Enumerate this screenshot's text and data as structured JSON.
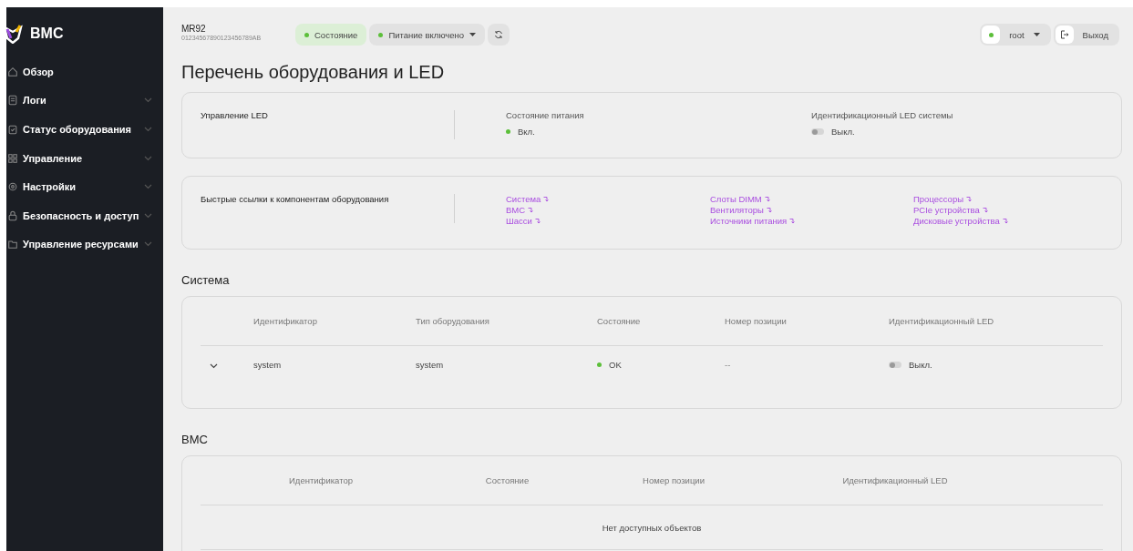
{
  "sidebar": {
    "brand": "BMC",
    "items": [
      {
        "label": "Обзор",
        "has_submenu": false
      },
      {
        "label": "Логи",
        "has_submenu": true
      },
      {
        "label": "Статус оборудования",
        "has_submenu": true
      },
      {
        "label": "Управление",
        "has_submenu": true
      },
      {
        "label": "Настройки",
        "has_submenu": true
      },
      {
        "label": "Безопасность и доступ",
        "has_submenu": true
      },
      {
        "label": "Управление ресурсами",
        "has_submenu": true
      }
    ]
  },
  "header": {
    "model": "MR92",
    "serial": "01234567890123456789AB",
    "status": {
      "label": "Состояние",
      "color": "#5cbf3a"
    },
    "power": {
      "label": "Питание включено",
      "color": "#5cbf3a"
    },
    "user": {
      "label": "root",
      "color": "#5cbf3a"
    },
    "logout": {
      "label": "Выход"
    }
  },
  "title": "Перечень оборудования и LED",
  "led_card": {
    "title": "Управление LED",
    "power": {
      "label": "Состояние питания",
      "value": "Вкл.",
      "color": "#5cbf3a"
    },
    "system_led": {
      "label": "Идентификационный LED системы",
      "value": "Выкл.",
      "on": false
    }
  },
  "quick_links": {
    "title": "Быстрые ссылки к компонентам оборудования",
    "columns": [
      [
        "Система",
        "BMC",
        "Шасси"
      ],
      [
        "Слоты DIMM",
        "Вентиляторы",
        "Источники питания"
      ],
      [
        "Процессоры",
        "PCIe устройства",
        "Дисковые устройства"
      ]
    ]
  },
  "system_section": {
    "heading": "Система",
    "columns": [
      "Идентификатор",
      "Тип оборудования",
      "Состояние",
      "Номер позиции",
      "Идентификационный LED"
    ],
    "rows": [
      {
        "expanded": false,
        "id": "system",
        "type": "system",
        "status": {
          "label": "OK",
          "color": "#5cbf3a"
        },
        "location": "--",
        "led": {
          "value": "Выкл.",
          "on": false
        }
      }
    ]
  },
  "bmc_section": {
    "heading": "BMC",
    "columns": [
      "Идентификатор",
      "Состояние",
      "Номер позиции",
      "Идентификационный LED"
    ],
    "empty_text": "Нет доступных объектов"
  }
}
